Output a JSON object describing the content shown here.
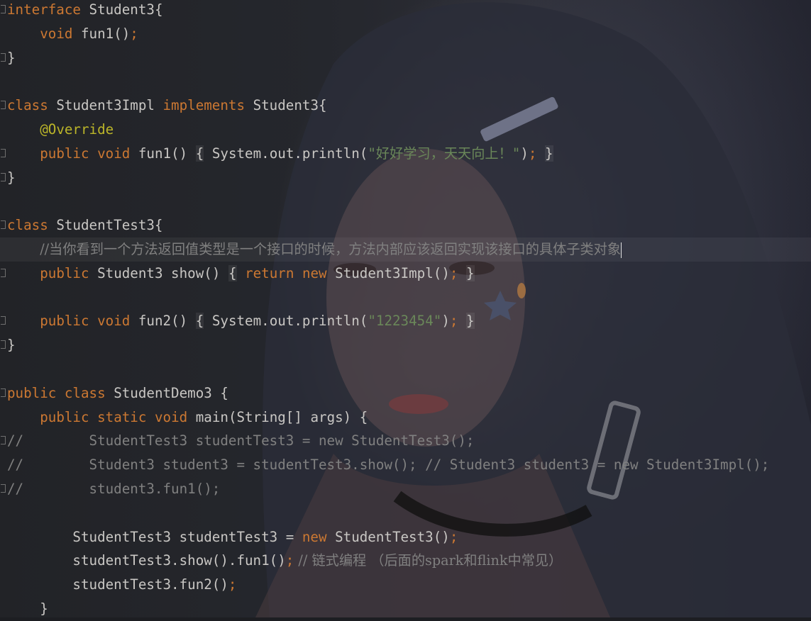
{
  "editor": {
    "lines": [
      {
        "tokens": [
          {
            "t": "interface ",
            "c": "kw"
          },
          {
            "t": "Student3{",
            "c": "plain"
          }
        ]
      },
      {
        "tokens": [
          {
            "t": "    ",
            "c": "plain"
          },
          {
            "t": "void ",
            "c": "kw"
          },
          {
            "t": "fun1()",
            "c": "plain"
          },
          {
            "t": ";",
            "c": "kw"
          }
        ]
      },
      {
        "tokens": [
          {
            "t": "}",
            "c": "plain"
          }
        ]
      },
      {
        "tokens": []
      },
      {
        "tokens": [
          {
            "t": "class ",
            "c": "kw"
          },
          {
            "t": "Student3Impl ",
            "c": "plain"
          },
          {
            "t": "implements ",
            "c": "kw"
          },
          {
            "t": "Student3{",
            "c": "plain"
          }
        ]
      },
      {
        "tokens": [
          {
            "t": "    ",
            "c": "plain"
          },
          {
            "t": "@Override",
            "c": "ann"
          }
        ]
      },
      {
        "tokens": [
          {
            "t": "    ",
            "c": "plain"
          },
          {
            "t": "public ",
            "c": "kw"
          },
          {
            "t": "void ",
            "c": "kw"
          },
          {
            "t": "fun1() ",
            "c": "plain"
          },
          {
            "t": "{",
            "c": "hl"
          },
          {
            "t": " System.out.println(",
            "c": "plain"
          },
          {
            "t": "\"好好学习，天天向上！\"",
            "c": "str"
          },
          {
            "t": ")",
            "c": "plain"
          },
          {
            "t": ";",
            "c": "kw"
          },
          {
            "t": " ",
            "c": "plain"
          },
          {
            "t": "}",
            "c": "hl"
          }
        ]
      },
      {
        "tokens": [
          {
            "t": "}",
            "c": "plain"
          }
        ]
      },
      {
        "tokens": []
      },
      {
        "tokens": [
          {
            "t": "class ",
            "c": "kw"
          },
          {
            "t": "StudentTest3{",
            "c": "plain"
          }
        ]
      },
      {
        "tokens": [
          {
            "t": "    ",
            "c": "plain"
          },
          {
            "t": "//当你看到一个方法返回值类型是一个接口的时候，方法内部应该返回实现该接口的具体子类对象",
            "c": "cmtzh"
          },
          {
            "t": "",
            "c": "caret"
          }
        ],
        "current": true
      },
      {
        "tokens": [
          {
            "t": "    ",
            "c": "plain"
          },
          {
            "t": "public ",
            "c": "kw"
          },
          {
            "t": "Student3 show() ",
            "c": "plain"
          },
          {
            "t": "{",
            "c": "hl"
          },
          {
            "t": " ",
            "c": "plain"
          },
          {
            "t": "return ",
            "c": "kw"
          },
          {
            "t": "new ",
            "c": "kw"
          },
          {
            "t": "Student3Impl()",
            "c": "plain"
          },
          {
            "t": ";",
            "c": "kw"
          },
          {
            "t": " ",
            "c": "plain"
          },
          {
            "t": "}",
            "c": "hl"
          }
        ]
      },
      {
        "tokens": []
      },
      {
        "tokens": [
          {
            "t": "    ",
            "c": "plain"
          },
          {
            "t": "public ",
            "c": "kw"
          },
          {
            "t": "void ",
            "c": "kw"
          },
          {
            "t": "fun2() ",
            "c": "plain"
          },
          {
            "t": "{",
            "c": "hl"
          },
          {
            "t": " System.out.println(",
            "c": "plain"
          },
          {
            "t": "\"1223454\"",
            "c": "str"
          },
          {
            "t": ")",
            "c": "plain"
          },
          {
            "t": ";",
            "c": "kw"
          },
          {
            "t": " ",
            "c": "plain"
          },
          {
            "t": "}",
            "c": "hl"
          }
        ]
      },
      {
        "tokens": [
          {
            "t": "}",
            "c": "plain"
          }
        ]
      },
      {
        "tokens": []
      },
      {
        "tokens": [
          {
            "t": "public ",
            "c": "kw"
          },
          {
            "t": "class ",
            "c": "kw"
          },
          {
            "t": "StudentDemo3 {",
            "c": "plain"
          }
        ]
      },
      {
        "tokens": [
          {
            "t": "    ",
            "c": "plain"
          },
          {
            "t": "public ",
            "c": "kw"
          },
          {
            "t": "static ",
            "c": "kw"
          },
          {
            "t": "void ",
            "c": "kw"
          },
          {
            "t": "main(String[] args) {",
            "c": "plain"
          }
        ]
      },
      {
        "tokens": [
          {
            "t": "//        StudentTest3 studentTest3 = new StudentTest3();",
            "c": "cmt"
          }
        ]
      },
      {
        "tokens": [
          {
            "t": "//        Student3 student3 = studentTest3.show(); // Student3 student3 = new Student3Impl();",
            "c": "cmt"
          }
        ]
      },
      {
        "tokens": [
          {
            "t": "//        student3.fun1();",
            "c": "cmt"
          }
        ]
      },
      {
        "tokens": []
      },
      {
        "tokens": [
          {
            "t": "        StudentTest3 studentTest3 = ",
            "c": "plain"
          },
          {
            "t": "new ",
            "c": "kw"
          },
          {
            "t": "StudentTest3()",
            "c": "plain"
          },
          {
            "t": ";",
            "c": "kw"
          }
        ]
      },
      {
        "tokens": [
          {
            "t": "        studentTest3.show().fun1()",
            "c": "plain"
          },
          {
            "t": ";",
            "c": "kw"
          },
          {
            "t": " // 链式编程 （后面的spark和flink中常见）",
            "c": "cmtzh"
          }
        ]
      },
      {
        "tokens": [
          {
            "t": "        studentTest3.fun2()",
            "c": "plain"
          },
          {
            "t": ";",
            "c": "kw"
          }
        ]
      },
      {
        "tokens": [
          {
            "t": "    }",
            "c": "plain"
          }
        ]
      }
    ],
    "fold_markers": [
      0,
      2,
      4,
      6,
      7,
      9,
      11,
      13,
      14,
      16,
      18,
      20
    ],
    "colors": {
      "keyword": "#cc7832",
      "string": "#6a8759",
      "annotation": "#bbb529",
      "comment": "#808080",
      "text": "#c9c7c4"
    }
  }
}
